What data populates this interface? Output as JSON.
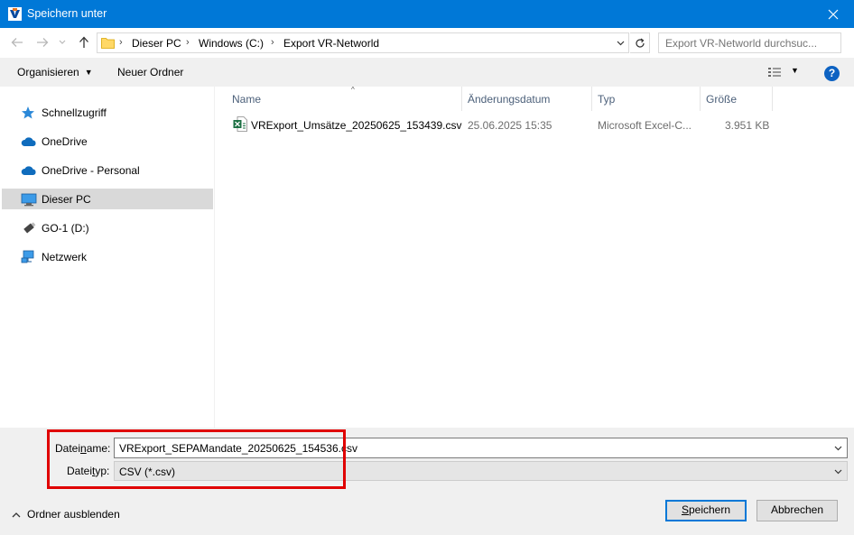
{
  "window": {
    "title": "Speichern unter",
    "title_bar_color": "#0078d7"
  },
  "navigation": {
    "back_icon": "arrow-left-icon",
    "forward_icon": "arrow-right-icon",
    "recent_icon": "chevron-down-icon",
    "up_icon": "arrow-up-icon",
    "breadcrumbs": [
      "Dieser PC",
      "Windows (C:)",
      "Export VR-Networld"
    ],
    "search_placeholder": "Export VR-Networld durchsuc..."
  },
  "toolbar": {
    "organize_label": "Organisieren",
    "new_folder_label": "Neuer Ordner",
    "help_label": "?"
  },
  "sidebar": {
    "items": [
      {
        "label": "Schnellzugriff",
        "icon": "star-icon"
      },
      {
        "label": "OneDrive",
        "icon": "cloud-icon"
      },
      {
        "label": "OneDrive - Personal",
        "icon": "cloud-icon"
      },
      {
        "label": "Dieser PC",
        "icon": "computer-icon",
        "selected": true
      },
      {
        "label": "GO-1 (D:)",
        "icon": "usb-drive-icon"
      },
      {
        "label": "Netzwerk",
        "icon": "network-icon"
      }
    ]
  },
  "file_list": {
    "columns": [
      "Name",
      "Änderungsdatum",
      "Typ",
      "Größe"
    ],
    "sort_indicator": "^",
    "rows": [
      {
        "name": "VRExport_Umsätze_20250625_153439.csv",
        "modified": "25.06.2025 15:35",
        "type": "Microsoft Excel-C...",
        "size": "3.951 KB",
        "icon": "excel-csv-icon"
      }
    ]
  },
  "bottom": {
    "filename_label_pre": "Datei",
    "filename_label_ul": "n",
    "filename_label_post": "ame:",
    "filename_value": "VRExport_SEPAMandate_20250625_154536.csv",
    "filetype_label_pre": "Datei",
    "filetype_label_ul": "t",
    "filetype_label_post": "yp:",
    "filetype_value": "CSV (*.csv)",
    "hide_folders_label": "Ordner ausblenden",
    "save_label_ul": "S",
    "save_label_rest": "peichern",
    "cancel_label": "Abbrechen",
    "highlight_color": "#e00000"
  }
}
